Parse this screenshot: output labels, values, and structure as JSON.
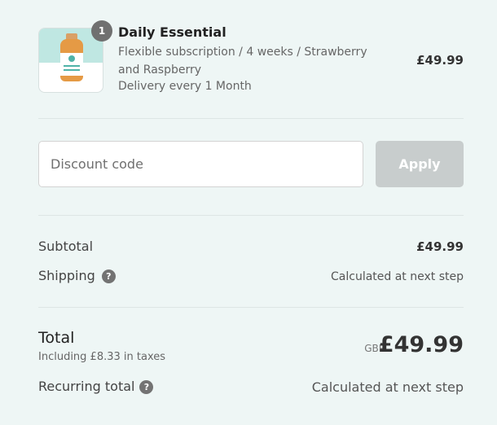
{
  "line_item": {
    "quantity": "1",
    "name": "Daily Essential",
    "variant": "Flexible subscription / 4 weeks / Strawberry and Raspberry",
    "delivery": "Delivery every 1 Month",
    "price": "£49.99"
  },
  "discount": {
    "placeholder": "Discount code",
    "value": "",
    "apply_label": "Apply"
  },
  "summary": {
    "subtotal_label": "Subtotal",
    "subtotal_value": "£49.99",
    "shipping_label": "Shipping",
    "shipping_value": "Calculated at next step",
    "total_label": "Total",
    "tax_note": "Including £8.33 in taxes",
    "currency": "GBP",
    "total_value": "£49.99",
    "recurring_label": "Recurring total",
    "recurring_value": "Calculated at next step"
  },
  "icons": {
    "help": "?"
  },
  "colors": {
    "page_background": "#eef6f5",
    "apply_button": "#c8cdcd",
    "badge": "#707070"
  }
}
